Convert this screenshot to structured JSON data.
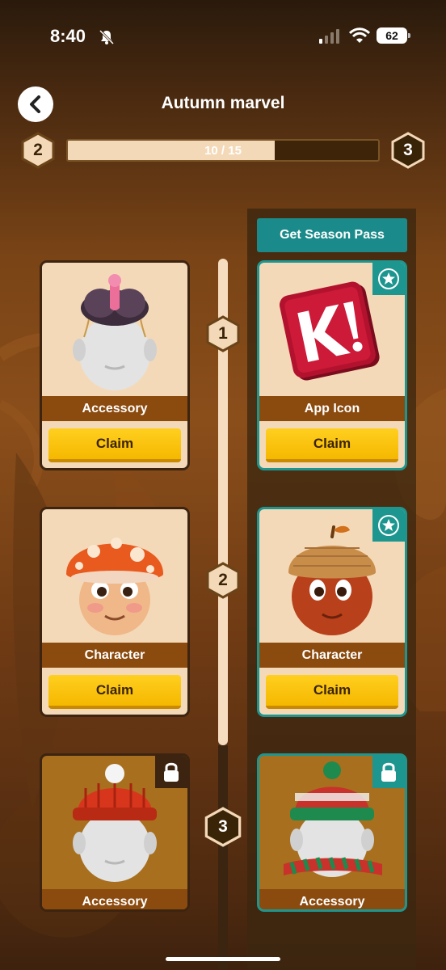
{
  "status_bar": {
    "time": "8:40",
    "battery": "62"
  },
  "header": {
    "title": "Autumn marvel"
  },
  "progress": {
    "current_level": "2",
    "next_level": "3",
    "text": "10 / 15",
    "fraction": 0.667
  },
  "season_pass": {
    "label": "Get Season Pass"
  },
  "levels": [
    {
      "number": "1",
      "free": {
        "type": "Accessory",
        "claim": "Claim"
      },
      "premium": {
        "type": "App Icon",
        "claim": "Claim"
      }
    },
    {
      "number": "2",
      "free": {
        "type": "Character",
        "claim": "Claim"
      },
      "premium": {
        "type": "Character",
        "claim": "Claim"
      }
    },
    {
      "number": "3",
      "free": {
        "type": "Accessory"
      },
      "premium": {
        "type": "Accessory"
      }
    }
  ],
  "colors": {
    "accent_teal": "#1e9690",
    "claim_yellow": "#f5b800",
    "label_brown": "#8b4a0e"
  }
}
